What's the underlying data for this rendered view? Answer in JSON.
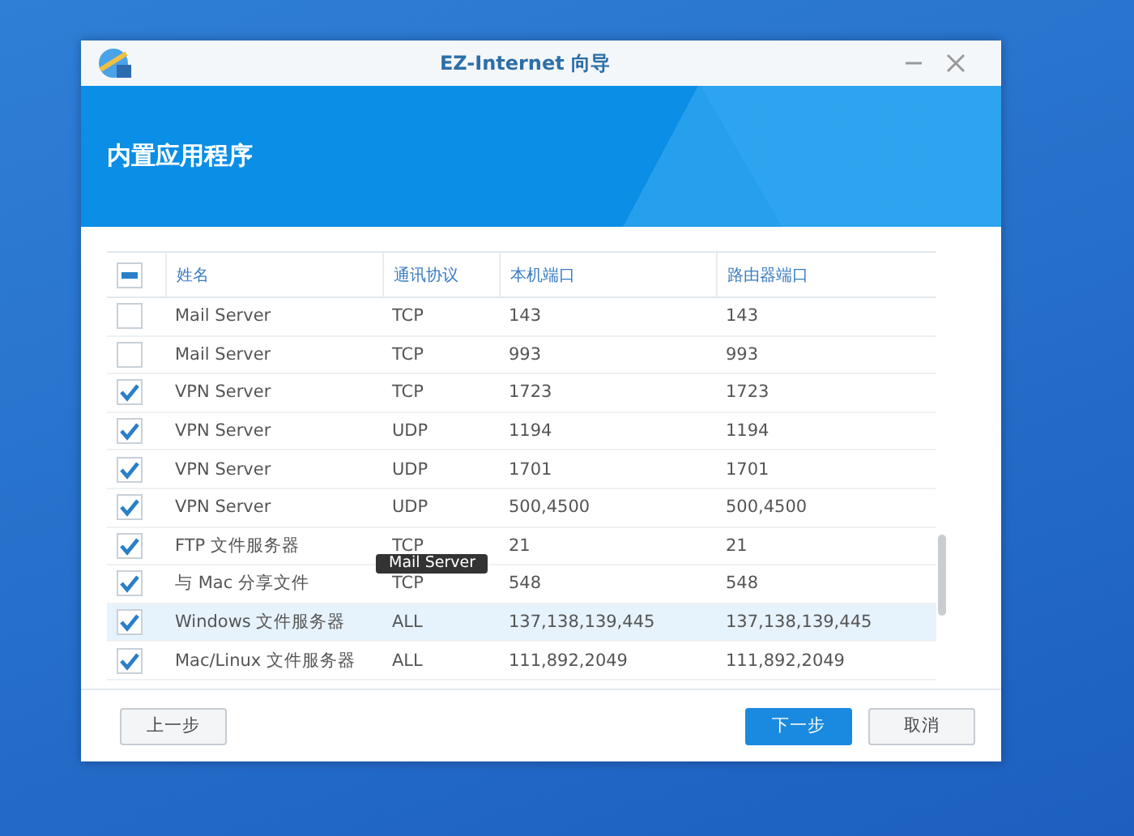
{
  "window": {
    "title": "EZ-Internet 向导"
  },
  "header": {
    "title": "内置应用程序"
  },
  "table": {
    "select_all": {
      "indeterminate": true
    },
    "columns": [
      "姓名",
      "通讯协议",
      "本机端口",
      "路由器端口"
    ],
    "rows": [
      {
        "checked": false,
        "selected": false,
        "cells": [
          "Mail Server",
          "TCP",
          "143",
          "143"
        ]
      },
      {
        "checked": false,
        "selected": false,
        "cells": [
          "Mail Server",
          "TCP",
          "993",
          "993"
        ]
      },
      {
        "checked": true,
        "selected": false,
        "cells": [
          "VPN Server",
          "TCP",
          "1723",
          "1723"
        ]
      },
      {
        "checked": true,
        "selected": false,
        "cells": [
          "VPN Server",
          "UDP",
          "1194",
          "1194"
        ]
      },
      {
        "checked": true,
        "selected": false,
        "cells": [
          "VPN Server",
          "UDP",
          "1701",
          "1701"
        ]
      },
      {
        "checked": true,
        "selected": false,
        "cells": [
          "VPN Server",
          "UDP",
          "500,4500",
          "500,4500"
        ]
      },
      {
        "checked": true,
        "selected": false,
        "cells": [
          "FTP 文件服务器",
          "TCP",
          "21",
          "21"
        ]
      },
      {
        "checked": true,
        "selected": false,
        "cells": [
          "与 Mac 分享文件",
          "TCP",
          "548",
          "548"
        ]
      },
      {
        "checked": true,
        "selected": true,
        "cells": [
          "Windows 文件服务器",
          "ALL",
          "137,138,139,445",
          "137,138,139,445"
        ]
      },
      {
        "checked": true,
        "selected": false,
        "cells": [
          "Mac/Linux 文件服务器",
          "ALL",
          "111,892,2049",
          "111,892,2049"
        ]
      }
    ]
  },
  "tooltip": {
    "text": "Mail Server"
  },
  "buttons": [
    {
      "label": "上一步",
      "kind": "secondary"
    },
    {
      "label": "下一步",
      "kind": "primary"
    },
    {
      "label": "取消",
      "kind": "secondary"
    }
  ]
}
